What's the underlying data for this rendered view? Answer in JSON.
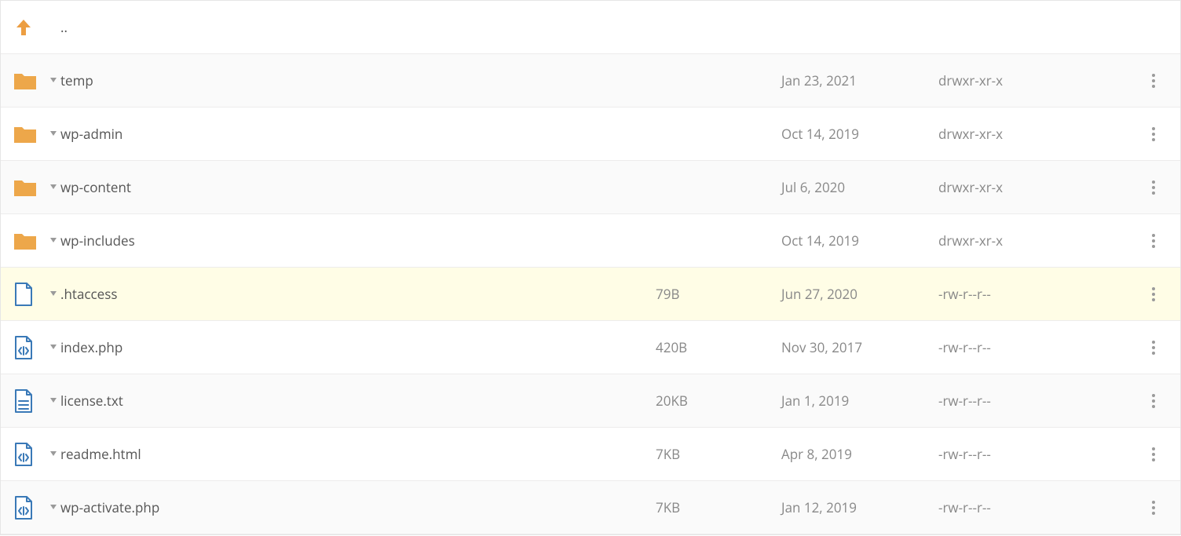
{
  "parentRow": {
    "name": ".."
  },
  "rows": [
    {
      "type": "folder",
      "name": "temp",
      "size": "",
      "date": "Jan 23, 2021",
      "perm": "drwxr-xr-x",
      "alt": true,
      "highlight": false
    },
    {
      "type": "folder",
      "name": "wp-admin",
      "size": "",
      "date": "Oct 14, 2019",
      "perm": "drwxr-xr-x",
      "alt": false,
      "highlight": false
    },
    {
      "type": "folder",
      "name": "wp-content",
      "size": "",
      "date": "Jul 6, 2020",
      "perm": "drwxr-xr-x",
      "alt": true,
      "highlight": false
    },
    {
      "type": "folder",
      "name": "wp-includes",
      "size": "",
      "date": "Oct 14, 2019",
      "perm": "drwxr-xr-x",
      "alt": false,
      "highlight": false
    },
    {
      "type": "file",
      "name": ".htaccess",
      "size": "79B",
      "date": "Jun 27, 2020",
      "perm": "-rw-r--r--",
      "alt": false,
      "highlight": true
    },
    {
      "type": "file-code",
      "name": "index.php",
      "size": "420B",
      "date": "Nov 30, 2017",
      "perm": "-rw-r--r--",
      "alt": false,
      "highlight": false
    },
    {
      "type": "file-text",
      "name": "license.txt",
      "size": "20KB",
      "date": "Jan 1, 2019",
      "perm": "-rw-r--r--",
      "alt": true,
      "highlight": false
    },
    {
      "type": "file-code",
      "name": "readme.html",
      "size": "7KB",
      "date": "Apr 8, 2019",
      "perm": "-rw-r--r--",
      "alt": false,
      "highlight": false
    },
    {
      "type": "file-code",
      "name": "wp-activate.php",
      "size": "7KB",
      "date": "Jan 12, 2019",
      "perm": "-rw-r--r--",
      "alt": true,
      "highlight": false
    }
  ]
}
